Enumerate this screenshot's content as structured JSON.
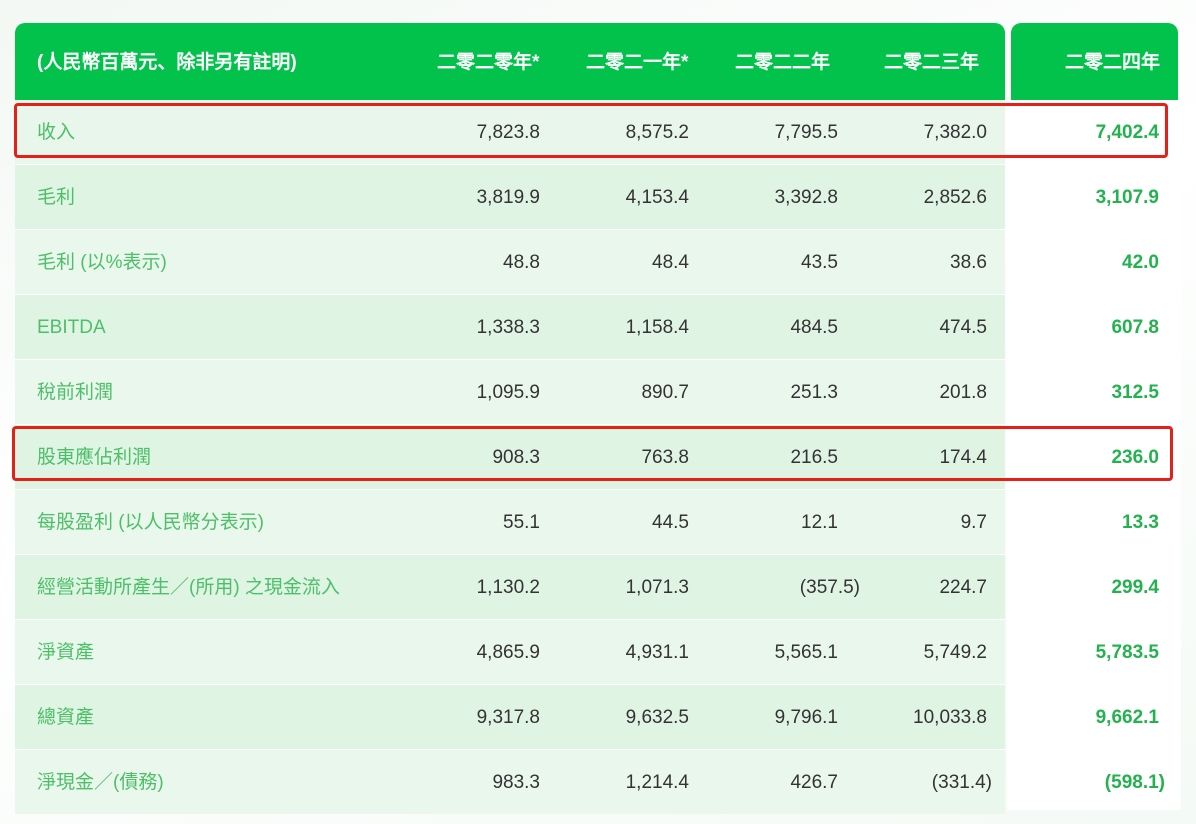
{
  "table": {
    "header": {
      "label": "(人民幣百萬元、除非另有註明)",
      "years": [
        "二零二零年*",
        "二零二一年*",
        "二零二二年",
        "二零二三年",
        "二零二四年"
      ]
    },
    "rows": [
      {
        "label": "收入",
        "values": [
          "7,823.8",
          "8,575.2",
          "7,795.5",
          "7,382.0",
          "7,402.4"
        ]
      },
      {
        "label": "毛利",
        "values": [
          "3,819.9",
          "4,153.4",
          "3,392.8",
          "2,852.6",
          "3,107.9"
        ]
      },
      {
        "label": "毛利 (以%表示)",
        "values": [
          "48.8",
          "48.4",
          "43.5",
          "38.6",
          "42.0"
        ]
      },
      {
        "label": "EBITDA",
        "values": [
          "1,338.3",
          "1,158.4",
          "484.5",
          "474.5",
          "607.8"
        ]
      },
      {
        "label": "稅前利潤",
        "values": [
          "1,095.9",
          "890.7",
          "251.3",
          "201.8",
          "312.5"
        ]
      },
      {
        "label": "股東應佔利潤",
        "values": [
          "908.3",
          "763.8",
          "216.5",
          "174.4",
          "236.0"
        ]
      },
      {
        "label": "每股盈利 (以人民幣分表示)",
        "values": [
          "55.1",
          "44.5",
          "12.1",
          "9.7",
          "13.3"
        ]
      },
      {
        "label": "經營活動所產生／(所用) 之現金流入",
        "values": [
          "1,130.2",
          "1,071.3",
          "(357.5)",
          "224.7",
          "299.4"
        ]
      },
      {
        "label": "淨資產",
        "values": [
          "4,865.9",
          "4,931.1",
          "5,565.1",
          "5,749.2",
          "5,783.5"
        ]
      },
      {
        "label": "總資產",
        "values": [
          "9,317.8",
          "9,632.5",
          "9,796.1",
          "10,033.8",
          "9,662.1"
        ]
      },
      {
        "label": "淨現金／(債務)",
        "values": [
          "983.3",
          "1,214.4",
          "426.7",
          "(331.4)",
          "(598.1)"
        ]
      }
    ]
  },
  "colors": {
    "header_bg": "#02c24b",
    "label_text": "#4cc068",
    "highlight_value": "#24b24f",
    "row_bg_a": "#eaf7ec",
    "row_bg_b": "#e0f4e4",
    "annotation_outline": "#e32119"
  }
}
